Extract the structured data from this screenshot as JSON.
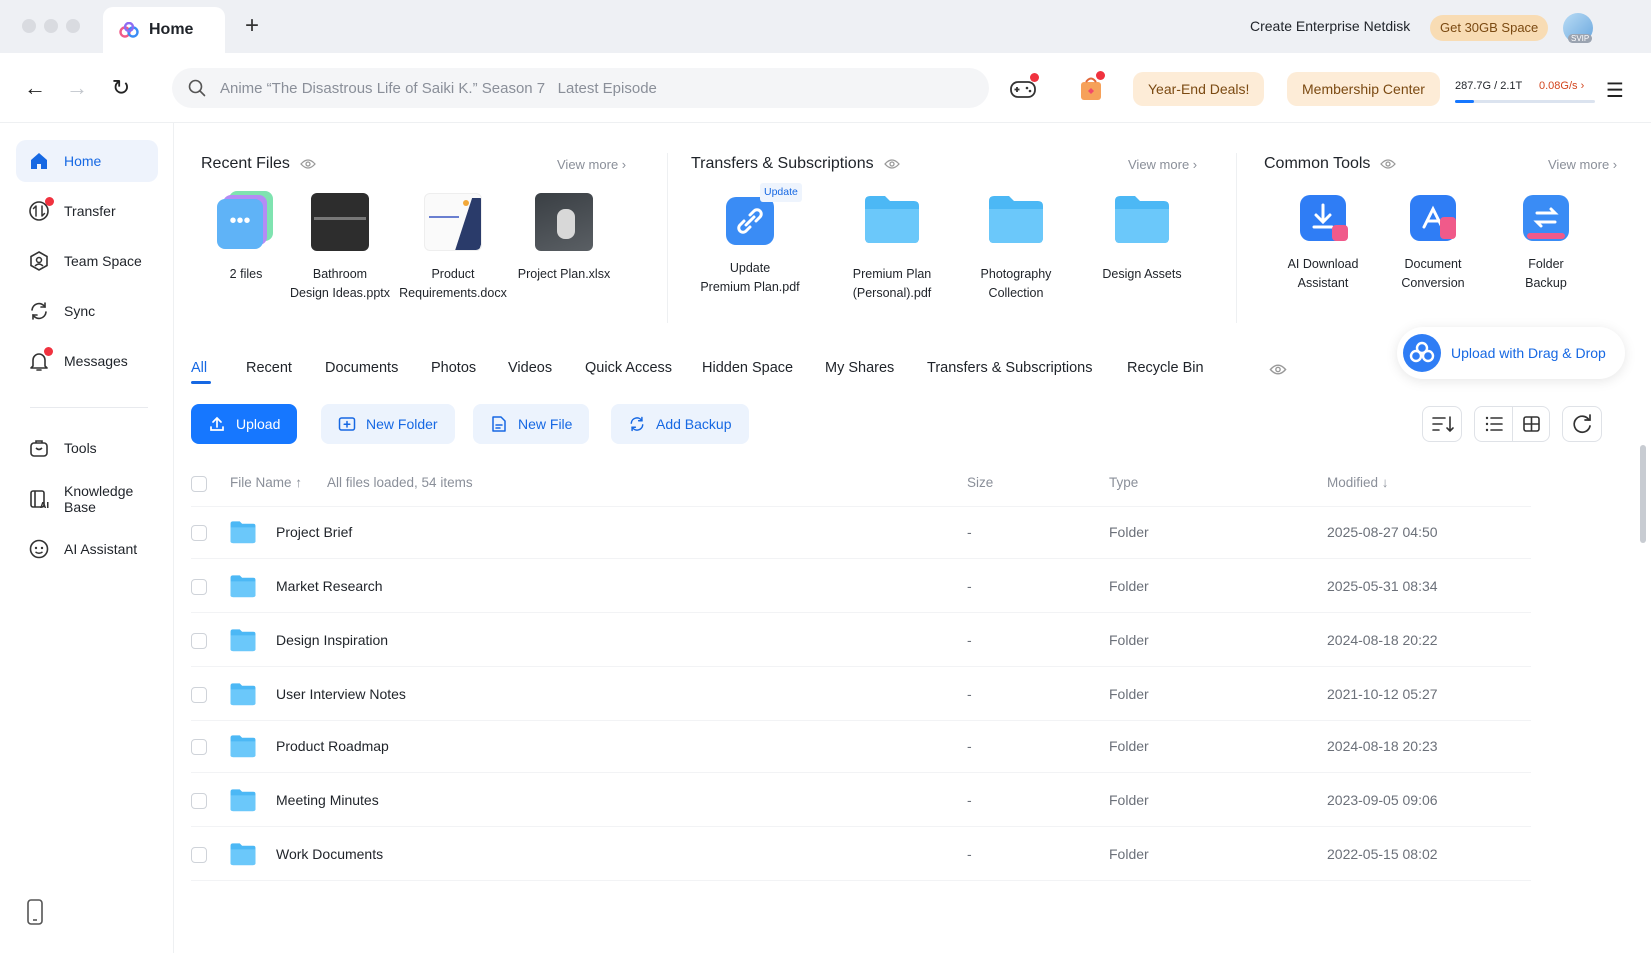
{
  "titlebar": {
    "tab_title": "Home",
    "new_tab": "+",
    "enterprise": "Create Enterprise Netdisk",
    "get_space": "Get 30GB Space",
    "svip": "SVIP"
  },
  "navbar": {
    "search_placeholder": "Anime “The Disastrous Life of Saiki K.” Season 7   Latest Episode",
    "deals": "Year-End Deals!",
    "membership": "Membership Center",
    "storage": "287.7G / 2.1T",
    "storage_used_fraction": 0.134,
    "speed": "0.08G/s"
  },
  "sidebar": {
    "items": [
      {
        "label": "Home",
        "icon": "home-icon"
      },
      {
        "label": "Transfer",
        "icon": "transfer-icon"
      },
      {
        "label": "Team Space",
        "icon": "team-space-icon"
      },
      {
        "label": "Sync",
        "icon": "sync-icon"
      },
      {
        "label": "Messages",
        "icon": "bell-icon"
      },
      {
        "label": "Tools",
        "icon": "tools-icon"
      },
      {
        "label": "Knowledge Base",
        "icon": "knowledge-base-icon"
      },
      {
        "label": "AI Assistant",
        "icon": "ai-assistant-icon"
      }
    ]
  },
  "recent": {
    "title": "Recent Files",
    "view_more": "View more",
    "items": [
      {
        "line1": "2 files",
        "line2": ""
      },
      {
        "line1": "Bathroom",
        "line2": "Design Ideas.pptx"
      },
      {
        "line1": "Product",
        "line2": "Requirements.docx"
      },
      {
        "line1": "Project Plan.xlsx",
        "line2": ""
      }
    ]
  },
  "transfers": {
    "title": "Transfers & Subscriptions",
    "view_more": "View more",
    "update_badge": "Update",
    "items": [
      {
        "line1": "Update",
        "line2": "Premium Plan.pdf"
      },
      {
        "line1": "Premium Plan",
        "line2": "(Personal).pdf"
      },
      {
        "line1": "Photography",
        "line2": "Collection"
      },
      {
        "line1": "Design Assets",
        "line2": ""
      }
    ]
  },
  "tools": {
    "title": "Common Tools",
    "view_more": "View more",
    "items": [
      {
        "line1": "AI Download",
        "line2": "Assistant"
      },
      {
        "line1": "Document",
        "line2": "Conversion"
      },
      {
        "line1": "Folder",
        "line2": "Backup"
      }
    ]
  },
  "upload_dnd": "Upload with Drag & Drop",
  "tabs": [
    "All",
    "Recent",
    "Documents",
    "Photos",
    "Videos",
    "Quick Access",
    "Hidden Space",
    "My Shares",
    "Transfers & Subscriptions",
    "Recycle Bin"
  ],
  "toolbar": {
    "upload": "Upload",
    "new_folder": "New Folder",
    "new_file": "New File",
    "add_backup": "Add Backup"
  },
  "table": {
    "col_name": "File Name ↑",
    "status": "All files loaded, 54 items",
    "col_size": "Size",
    "col_type": "Type",
    "col_modified": "Modified ↓",
    "rows": [
      {
        "name": "Project Brief",
        "size": "-",
        "type": "Folder",
        "modified": "2025-08-27 04:50"
      },
      {
        "name": "Market Research",
        "size": "-",
        "type": "Folder",
        "modified": "2025-05-31 08:34"
      },
      {
        "name": "Design Inspiration",
        "size": "-",
        "type": "Folder",
        "modified": "2024-08-18 20:22"
      },
      {
        "name": "User Interview Notes",
        "size": "-",
        "type": "Folder",
        "modified": "2021-10-12 05:27"
      },
      {
        "name": "Product Roadmap",
        "size": "-",
        "type": "Folder",
        "modified": "2024-08-18 20:23"
      },
      {
        "name": "Meeting Minutes",
        "size": "-",
        "type": "Folder",
        "modified": "2023-09-05 09:06"
      },
      {
        "name": "Work Documents",
        "size": "-",
        "type": "Folder",
        "modified": "2022-05-15 08:02"
      }
    ]
  },
  "colors": {
    "accent": "#1677ff",
    "folder": "#4cb8f5",
    "badge_red": "#f0323f"
  }
}
